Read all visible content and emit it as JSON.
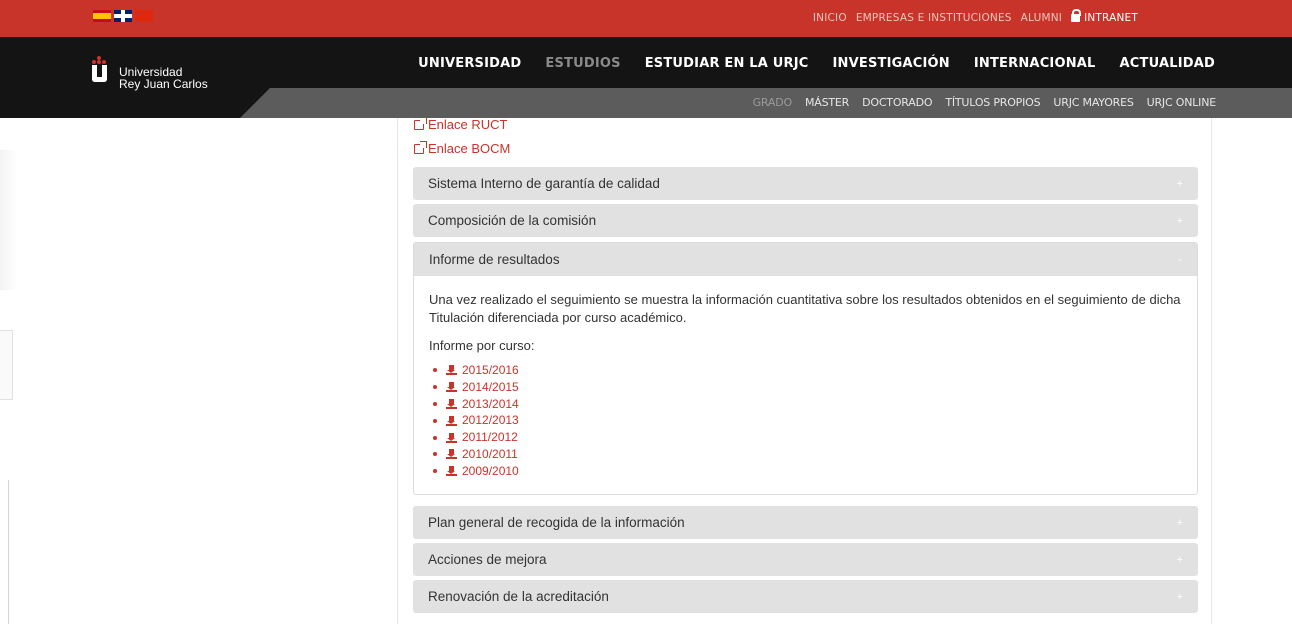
{
  "topbar": {
    "flags": [
      "es-flag",
      "uk-flag",
      "cn-flag"
    ],
    "links": [
      "INICIO",
      "EMPRESAS E INSTITUCIONES",
      "ALUMNI"
    ],
    "intranet": "INTRANET"
  },
  "logo": {
    "line1": "Universidad",
    "line2": "Rey Juan Carlos"
  },
  "mainnav": [
    "UNIVERSIDAD",
    "ESTUDIOS",
    "ESTUDIAR EN LA URJC",
    "INVESTIGACIÓN",
    "INTERNACIONAL",
    "ACTUALIDAD"
  ],
  "subnav": [
    "GRADO",
    "MÁSTER",
    "DOCTORADO",
    "TÍTULOS PROPIOS",
    "URJC MAYORES",
    "URJC ONLINE"
  ],
  "links": {
    "ruct": "Enlace RUCT",
    "bocm": "Enlace BOCM"
  },
  "accordion": {
    "sistema": "Sistema Interno de garantía de calidad",
    "composicion": "Composición de la comisión",
    "informe": "Informe de resultados",
    "plan": "Plan general de recogida de la información",
    "acciones": "Acciones de mejora",
    "renovacion": "Renovación de la acreditación",
    "plus": "+",
    "minus": "-"
  },
  "informe": {
    "description": "Una vez realizado el seguimiento se muestra la información cuantitativa sobre los resultados obtenidos en el seguimiento de dicha Titulación diferenciada por curso académico.",
    "subtitle": "Informe por curso:",
    "years": [
      "2015/2016",
      "2014/2015",
      "2013/2014",
      "2012/2013",
      "2011/2012",
      "2010/2011",
      "2009/2010"
    ]
  },
  "colors": {
    "brand_red": "#c8342a",
    "header_black": "#141414",
    "subbar_gray": "#5c5c5c",
    "accordion_gray": "#e1e1e1"
  }
}
